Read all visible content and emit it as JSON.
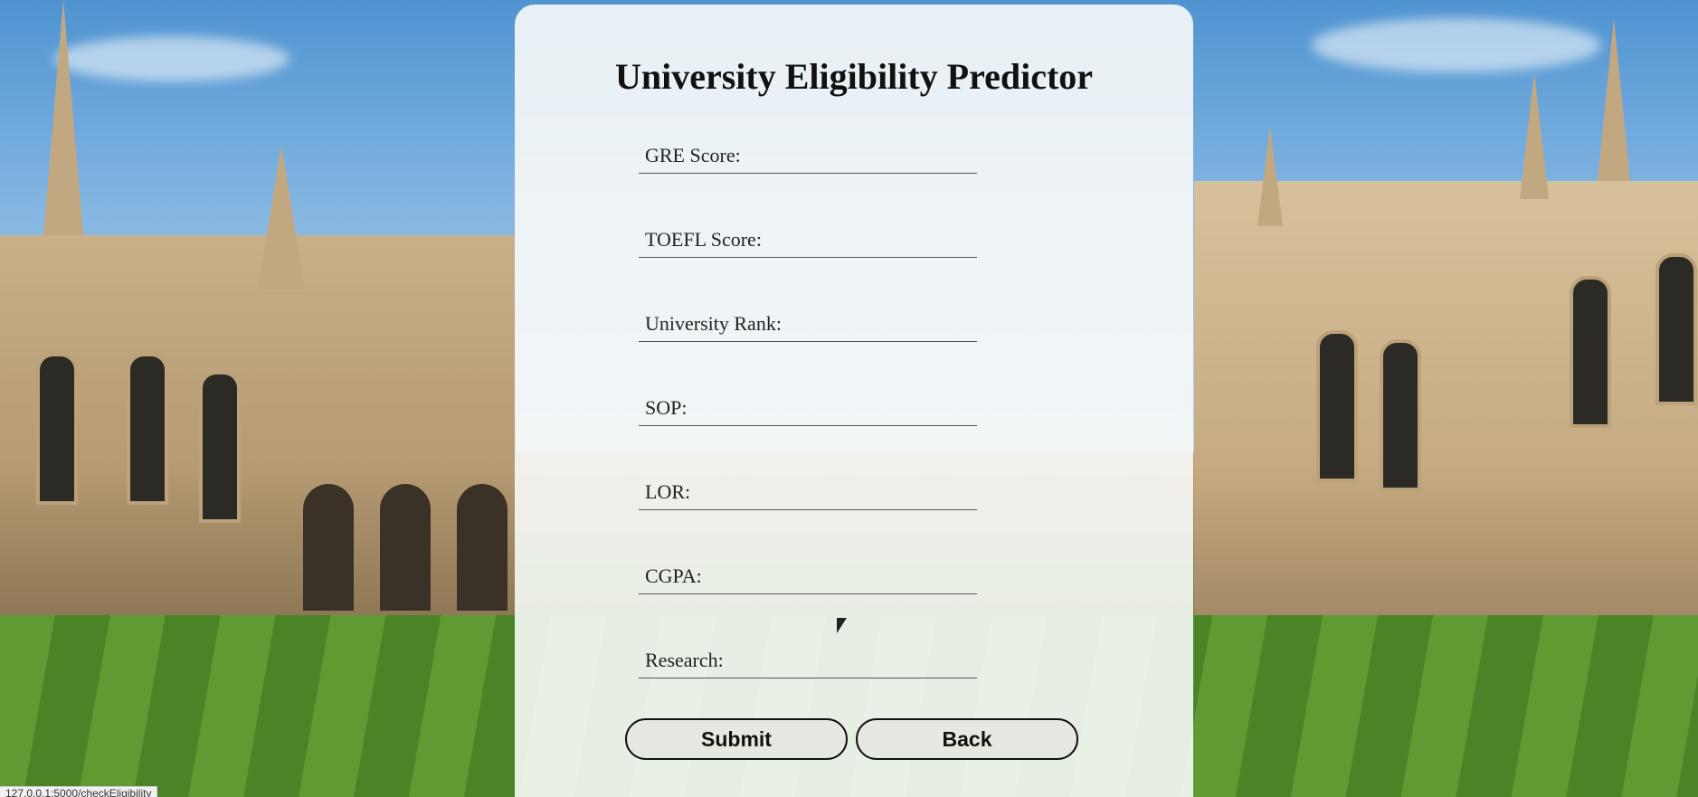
{
  "form": {
    "title": "University Eligibility Predictor",
    "fields": [
      {
        "label": "GRE Score:"
      },
      {
        "label": "TOEFL Score:"
      },
      {
        "label": "University Rank:"
      },
      {
        "label": "SOP:"
      },
      {
        "label": "LOR:"
      },
      {
        "label": "CGPA:"
      },
      {
        "label": "Research:"
      }
    ],
    "submit_label": "Submit",
    "back_label": "Back"
  },
  "status_bar": {
    "url": "127.0.0.1:5000/checkEligibility"
  }
}
